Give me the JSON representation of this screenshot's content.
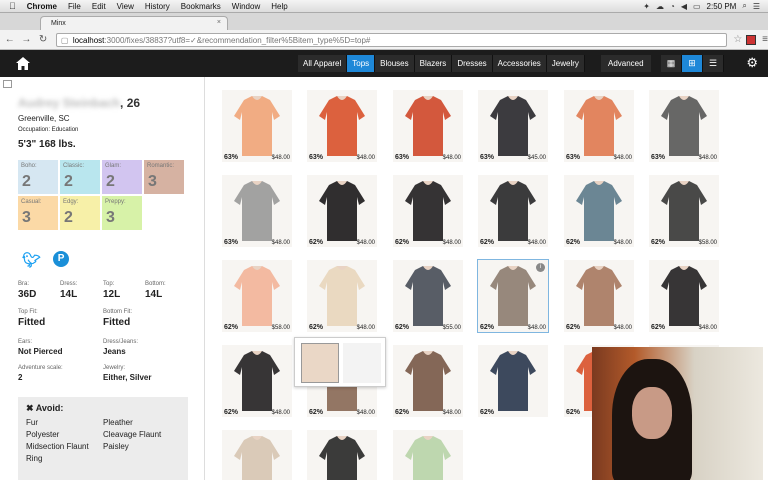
{
  "mac_menu": {
    "app": "Chrome",
    "items": [
      "File",
      "Edit",
      "View",
      "History",
      "Bookmarks",
      "Window",
      "Help"
    ],
    "clock": "2:50 PM"
  },
  "browser": {
    "tab_title": "Minx",
    "url_host": "localhost",
    "url_path": ":3000/fixes/38837?utf8=✓&recommendation_filter%5Bitem_type%5D=top#"
  },
  "nav": {
    "categories": [
      "All Apparel",
      "Tops",
      "Blouses",
      "Blazers",
      "Dresses",
      "Accessories",
      "Jewelry"
    ],
    "active_category": "Tops",
    "advanced_label": "Advanced"
  },
  "profile": {
    "name_blurred": "Audrey Steinbach",
    "age": ", 26",
    "location": "Greenville, SC",
    "occupation": "Occupation: Education",
    "size": "5'3\" 168 lbs.",
    "styles": [
      {
        "label": "Boho:",
        "value": "2",
        "color": "#d6e7f2"
      },
      {
        "label": "Classic:",
        "value": "2",
        "color": "#b9e6ee"
      },
      {
        "label": "Glam:",
        "value": "2",
        "color": "#d2c5f0"
      },
      {
        "label": "Romantic:",
        "value": "3",
        "color": "#d6b2a2"
      },
      {
        "label": "Casual:",
        "value": "3",
        "color": "#fbd9a6"
      },
      {
        "label": "Edgy:",
        "value": "2",
        "color": "#f7f0a8"
      },
      {
        "label": "Preppy:",
        "value": "3",
        "color": "#d7f2a8"
      }
    ],
    "attributes": {
      "bra_label": "Bra:",
      "bra": "36D",
      "dress_label": "Dress:",
      "dress": "14L",
      "top_label": "Top:",
      "top": "12L",
      "bottom_label": "Bottom:",
      "bottom": "14L",
      "top_fit_label": "Top Fit:",
      "top_fit": "Fitted",
      "bottom_fit_label": "Bottom Fit:",
      "bottom_fit": "Fitted",
      "ears_label": "Ears:",
      "ears": "Not Pierced",
      "dress_jeans_label": "Dress/Jeans:",
      "dress_jeans": "Jeans",
      "adventure_label": "Adventure scale:",
      "adventure": "2",
      "jewelry_label": "Jewelry:",
      "jewelry": "Either, Silver"
    },
    "avoid_title": "✖ Avoid:",
    "avoid_col1": [
      "Fur",
      "Polyester",
      "Midsection Flaunt",
      "Ring"
    ],
    "avoid_col2": [
      "Pleather",
      "Cleavage Flaunt",
      "Paisley"
    ]
  },
  "products": [
    {
      "pct": "63%",
      "price": "$48.00",
      "color": "#f0a57a"
    },
    {
      "pct": "63%",
      "price": "$48.00",
      "color": "#d9542f"
    },
    {
      "pct": "63%",
      "price": "$48.00",
      "color": "#cf4a2e"
    },
    {
      "pct": "63%",
      "price": "$45.00",
      "color": "#2b2a30"
    },
    {
      "pct": "63%",
      "price": "$48.00",
      "color": "#e07b52"
    },
    {
      "pct": "63%",
      "price": "$48.00",
      "color": "#5a5a5a"
    },
    {
      "pct": "63%",
      "price": "$48.00",
      "color": "#9a9a9a"
    },
    {
      "pct": "62%",
      "price": "$48.00",
      "color": "#1e1c1e"
    },
    {
      "pct": "62%",
      "price": "$48.00",
      "color": "#242224"
    },
    {
      "pct": "62%",
      "price": "$48.00",
      "color": "#2a2a2c"
    },
    {
      "pct": "62%",
      "price": "$48.00",
      "color": "#5e7c8c"
    },
    {
      "pct": "62%",
      "price": "$58.00",
      "color": "#3a3a3a"
    },
    {
      "pct": "62%",
      "price": "$58.00",
      "color": "#f2b49a"
    },
    {
      "pct": "62%",
      "price": "$48.00",
      "color": "#e8d6bd"
    },
    {
      "pct": "62%",
      "price": "$55.00",
      "color": "#4a4f5a"
    },
    {
      "pct": "62%",
      "price": "$48.00",
      "color": "#8e7e72"
    },
    {
      "pct": "62%",
      "price": "$48.00",
      "color": "#a87a62"
    },
    {
      "pct": "62%",
      "price": "$48.00",
      "color": "#262426"
    },
    {
      "pct": "62%",
      "price": "$48.00",
      "color": "#262426"
    },
    {
      "pct": "62%",
      "price": "$48.00",
      "color": "#8a6a58"
    },
    {
      "pct": "62%",
      "price": "$48.00",
      "color": "#7a5a4a"
    },
    {
      "pct": "62%",
      "price": "",
      "color": "#2c3a50"
    },
    {
      "pct": "62%",
      "price": "",
      "color": "#d9542f"
    },
    {
      "pct": "",
      "price": "",
      "color": "#e0a080"
    },
    {
      "pct": "",
      "price": "",
      "color": "#d7c6b3"
    },
    {
      "pct": "",
      "price": "",
      "color": "#2a2a2a"
    },
    {
      "pct": "",
      "price": "",
      "color": "#b9d4a9"
    }
  ],
  "colors": {
    "accent": "#1e88d8",
    "nav_bg": "#1c1c1c"
  }
}
